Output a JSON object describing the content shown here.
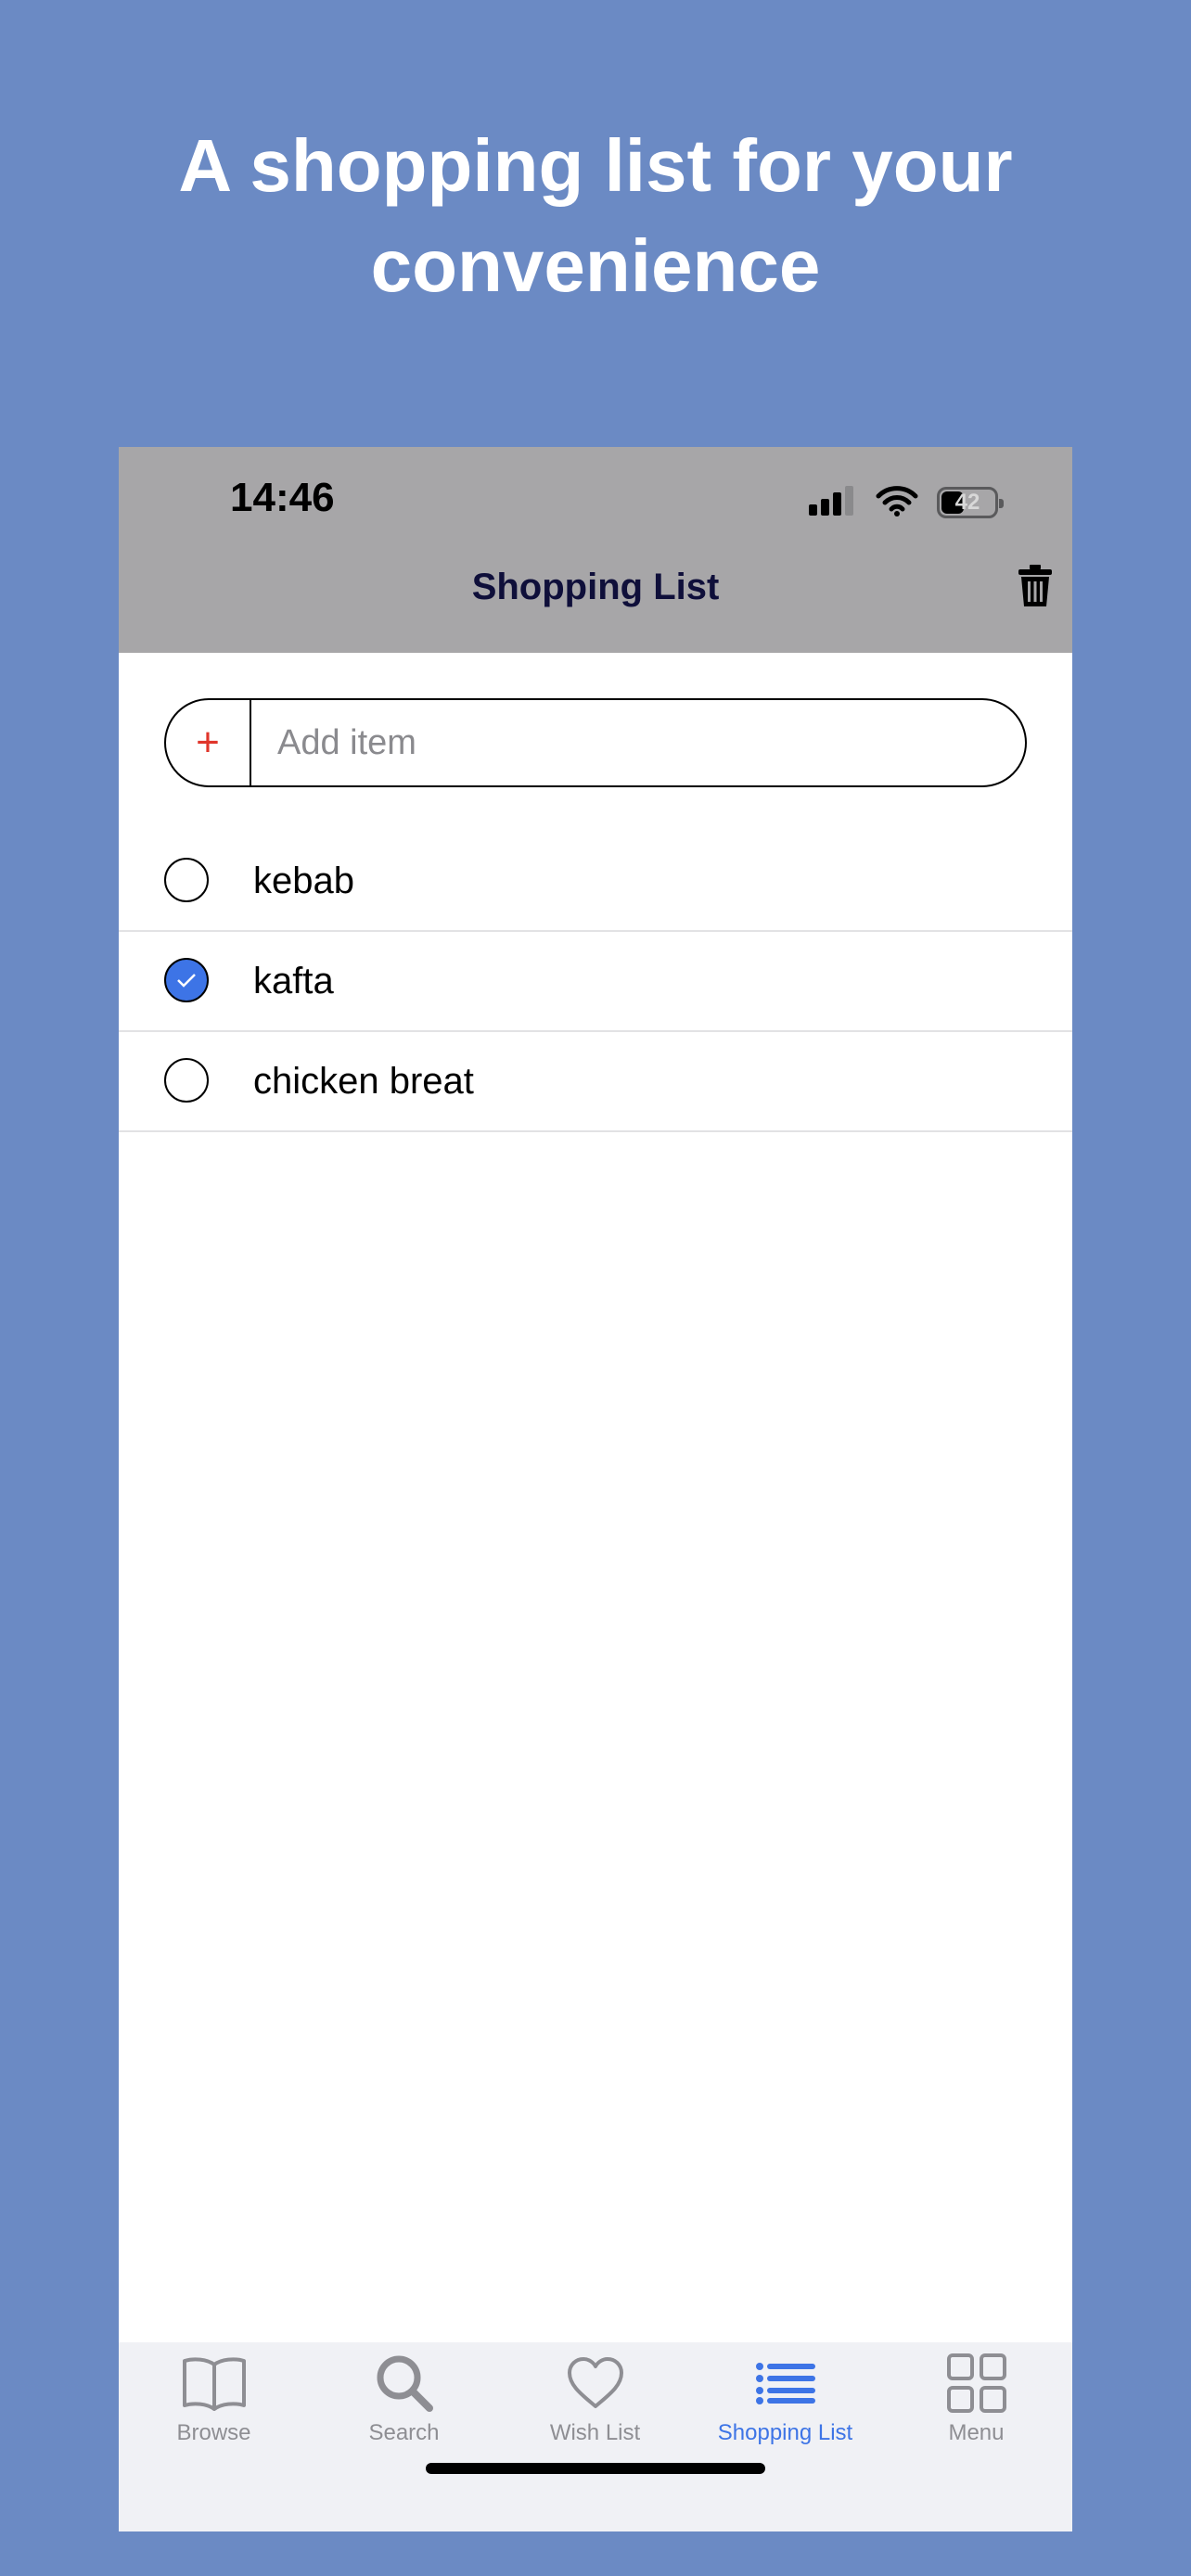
{
  "promo": {
    "title_line1": "A shopping list for your",
    "title_line2": "convenience"
  },
  "status_bar": {
    "time": "14:46",
    "battery": "42",
    "battery_level": 0.42
  },
  "nav": {
    "title": "Shopping List",
    "trash_icon": "trash-icon"
  },
  "add_item": {
    "plus": "+",
    "placeholder": "Add item",
    "value": ""
  },
  "items": [
    {
      "label": "kebab",
      "checked": false
    },
    {
      "label": "kafta",
      "checked": true
    },
    {
      "label": "chicken breat",
      "checked": false
    }
  ],
  "tabs": [
    {
      "label": "Browse",
      "icon": "book-icon",
      "active": false
    },
    {
      "label": "Search",
      "icon": "search-icon",
      "active": false
    },
    {
      "label": "Wish List",
      "icon": "heart-icon",
      "active": false
    },
    {
      "label": "Shopping List",
      "icon": "list-icon",
      "active": true
    },
    {
      "label": "Menu",
      "icon": "grid-icon",
      "active": false
    }
  ],
  "colors": {
    "background": "#6b8ac4",
    "header": "#a7a6a8",
    "accent": "#3d74e6",
    "plus": "#e0352b",
    "tab_inactive": "#8e8e93"
  }
}
